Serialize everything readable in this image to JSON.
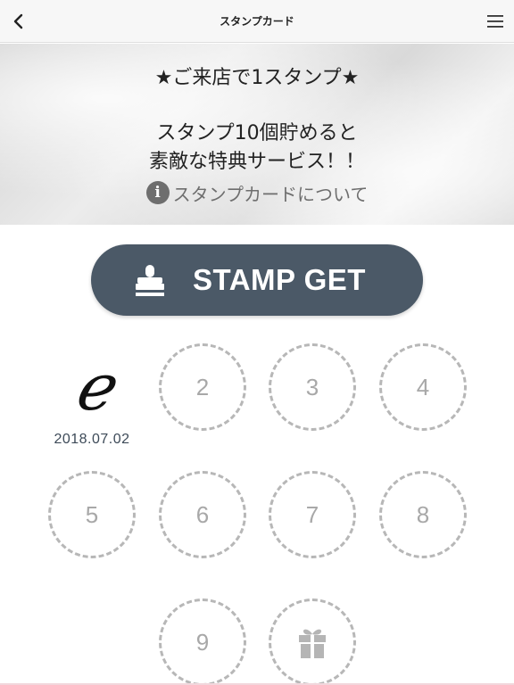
{
  "nav": {
    "title": "スタンプカード",
    "back_icon": "chevron-left-icon",
    "menu_icon": "hamburger-menu-icon"
  },
  "banner": {
    "line1": "★ご来店で1スタンプ★",
    "line2": "スタンプ10個貯めると",
    "line3": "素敵な特典サービス！！",
    "about_label": "スタンプカードについて",
    "about_icon": "info-icon"
  },
  "stamp_button": {
    "label": "STAMP GET",
    "icon": "stamp-icon",
    "color": "#4b5967"
  },
  "card": {
    "stamped": {
      "mark": "ℯ",
      "date": "2018.07.02"
    },
    "slots": [
      "2",
      "3",
      "4",
      "5",
      "6",
      "7",
      "8",
      "9"
    ],
    "reward_icon": "gift-icon"
  }
}
